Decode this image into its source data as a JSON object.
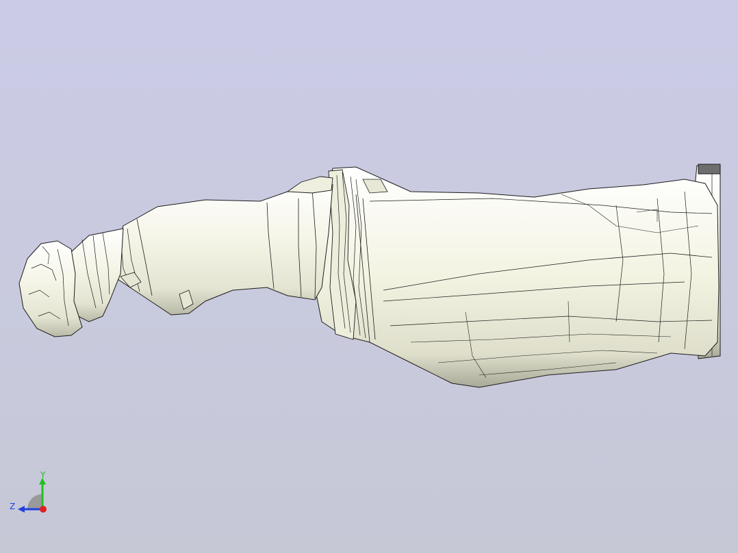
{
  "viewport": {
    "background_top": "#cbcbe6",
    "background_bottom": "#c6c8d6"
  },
  "model": {
    "surface_color": "#f2f2e4",
    "edge_color": "#1a1a1a"
  },
  "triad": {
    "x_axis_color": "#e02020",
    "y_axis_color": "#20c020",
    "z_axis_color": "#2040e0",
    "y_label": "Y",
    "z_label": "Z"
  }
}
